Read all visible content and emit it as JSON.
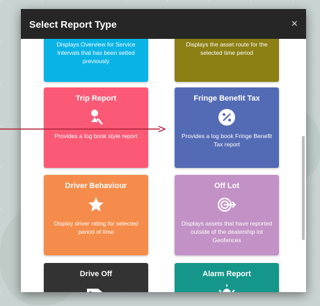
{
  "modal": {
    "title": "Select Report Type",
    "close_label": "×"
  },
  "cards": [
    {
      "title": "",
      "description": "Displays Overview for Service Intervals that has been setted previously",
      "color": "#0ab3e6"
    },
    {
      "title": "",
      "description": "Displays the asset route for the selected time period",
      "color": "#8c7f13"
    },
    {
      "title": "Trip Report",
      "icon": "map-pin-person-icon",
      "description": "Provides a log book style report",
      "color": "#fb5975"
    },
    {
      "title": "Fringe Benefit Tax",
      "icon": "percent-icon",
      "description": "Provides a log book Fringe Benefit Tax report",
      "color": "#536bb5"
    },
    {
      "title": "Driver Behaviour",
      "icon": "star-icon",
      "description": "Display driver rating for selected period of time",
      "color": "#f58c4b"
    },
    {
      "title": "Off Lot",
      "icon": "target-arrow-icon",
      "description": "Displays assets that have reported outside of the dealership lot Geofences",
      "color": "#c291c6"
    },
    {
      "title": "Drive Off",
      "icon": "tag-icon",
      "description": "",
      "color": "#333333"
    },
    {
      "title": "Alarm Report",
      "icon": "alarm-bell-icon",
      "description": "",
      "color": "#14978a"
    }
  ],
  "annotation": {
    "arrow_color": "#b0203a"
  }
}
